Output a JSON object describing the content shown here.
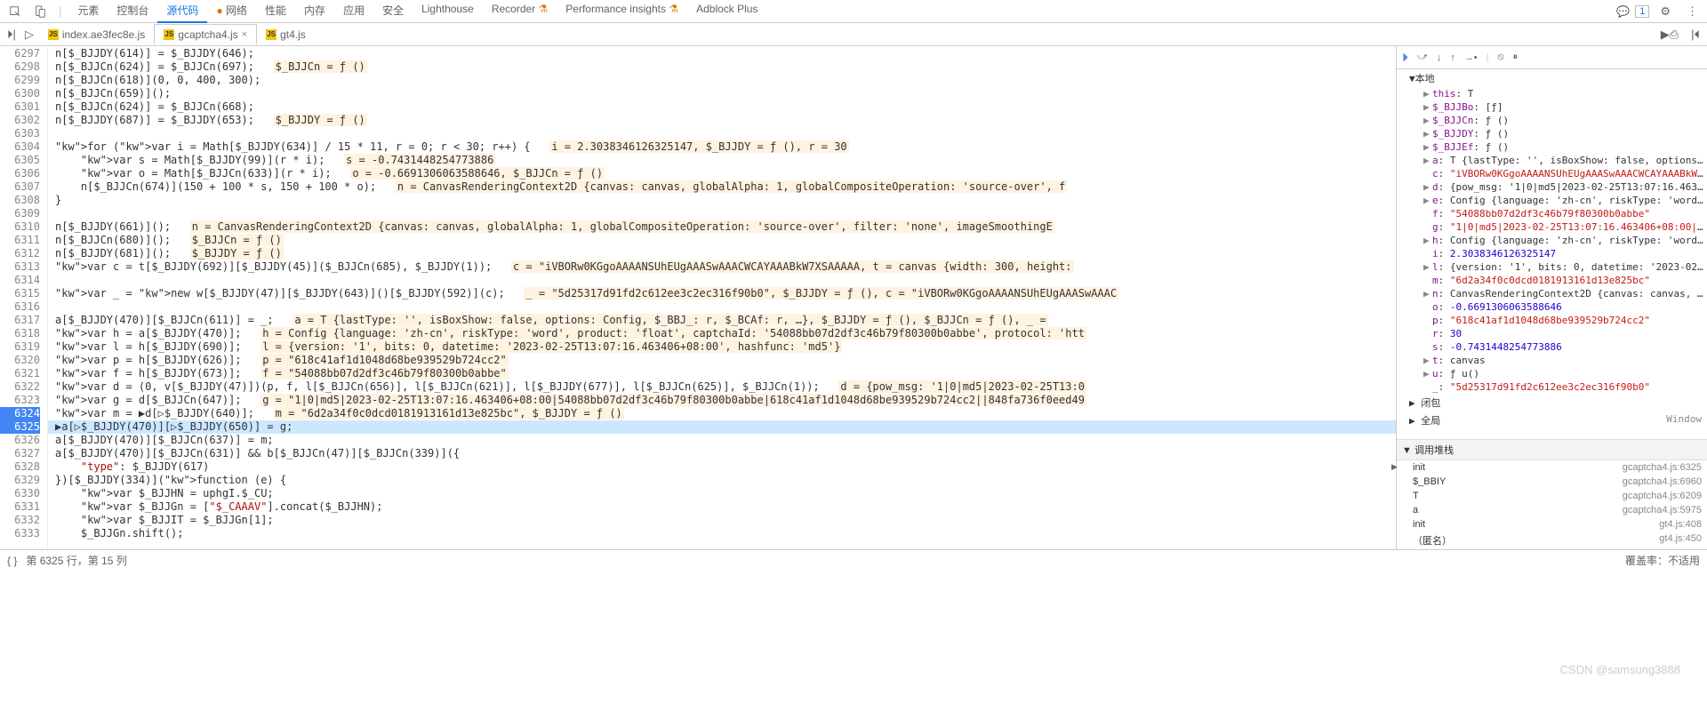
{
  "toolbar": {
    "tabs": [
      "元素",
      "控制台",
      "源代码",
      "网络",
      "性能",
      "内存",
      "应用",
      "安全",
      "Lighthouse",
      "Recorder",
      "Performance insights",
      "Adblock Plus"
    ],
    "active_tab_index": 2,
    "experimental_indices": [
      9,
      10
    ],
    "network_warn": true,
    "messages_count": "1"
  },
  "file_tabs": {
    "items": [
      {
        "name": "index.ae3fec8e.js",
        "active": false,
        "closeable": false
      },
      {
        "name": "gcaptcha4.js",
        "active": true,
        "closeable": true
      },
      {
        "name": "gt4.js",
        "active": false,
        "closeable": false
      }
    ]
  },
  "gutter": {
    "start": 6297,
    "end": 6333,
    "breakpoints": [
      6324,
      6325
    ],
    "exec_line": 6325
  },
  "code_lines": [
    {
      "n": 6297,
      "t": "n[$_BJJDY(614)] = $_BJJDY(646);"
    },
    {
      "n": 6298,
      "t": "n[$_BJJCn(624)] = $_BJJCn(697);",
      "inl": "$_BJJCn = ƒ ()"
    },
    {
      "n": 6299,
      "t": "n[$_BJJCn(618)](0, 0, 400, 300);"
    },
    {
      "n": 6300,
      "t": "n[$_BJJCn(659)]();"
    },
    {
      "n": 6301,
      "t": "n[$_BJJCn(624)] = $_BJJCn(668);"
    },
    {
      "n": 6302,
      "t": "n[$_BJJDY(687)] = $_BJJDY(653);",
      "inl": "$_BJJDY = ƒ ()"
    },
    {
      "n": 6303,
      "t": ""
    },
    {
      "n": 6304,
      "t": "for (var i = Math[$_BJJDY(634)] / 15 * 11, r = 0; r < 30; r++) {",
      "inl": "i = 2.3038346126325147, $_BJJDY = ƒ (), r = 30"
    },
    {
      "n": 6305,
      "t": "    var s = Math[$_BJJDY(99)](r * i);",
      "inl": "s = -0.7431448254773886"
    },
    {
      "n": 6306,
      "t": "    var o = Math[$_BJJCn(633)](r * i);",
      "inl": "o = -0.6691306063588646, $_BJJCn = ƒ ()"
    },
    {
      "n": 6307,
      "t": "    n[$_BJJCn(674)](150 + 100 * s, 150 + 100 * o);",
      "inl": "n = CanvasRenderingContext2D {canvas: canvas, globalAlpha: 1, globalCompositeOperation: 'source-over', f"
    },
    {
      "n": 6308,
      "t": "}"
    },
    {
      "n": 6309,
      "t": ""
    },
    {
      "n": 6310,
      "t": "n[$_BJJDY(661)]();",
      "inl": "n = CanvasRenderingContext2D {canvas: canvas, globalAlpha: 1, globalCompositeOperation: 'source-over', filter: 'none', imageSmoothingE"
    },
    {
      "n": 6311,
      "t": "n[$_BJJCn(680)]();",
      "inl": "$_BJJCn = ƒ ()"
    },
    {
      "n": 6312,
      "t": "n[$_BJJDY(681)]();",
      "inl": "$_BJJDY = ƒ ()"
    },
    {
      "n": 6313,
      "t": "var c = t[$_BJJDY(692)][$_BJJDY(45)]($_BJJCn(685), $_BJJDY(1));",
      "inl": "c = \"iVBORw0KGgoAAAANSUhEUgAAASwAAACWCAYAAABkW7XSAAAAA, t = canvas {width: 300, height:"
    },
    {
      "n": 6314,
      "t": ""
    },
    {
      "n": 6315,
      "t": "var _ = new w[$_BJJDY(47)][$_BJJDY(643)]()[$_BJJDY(592)](c);",
      "inl": "_ = \"5d25317d91fd2c612ee3c2ec316f90b0\", $_BJJDY = ƒ (), c = \"iVBORw0KGgoAAAANSUhEUgAAASwAAAC"
    },
    {
      "n": 6316,
      "t": ""
    },
    {
      "n": 6317,
      "t": "a[$_BJJDY(470)][$_BJJCn(611)] = _;",
      "inl": "a = T {lastType: '', isBoxShow: false, options: Config, $_BBJ_: r, $_BCAf: r, …}, $_BJJDY = ƒ (), $_BJJCn = ƒ (), _ ="
    },
    {
      "n": 6318,
      "t": "var h = a[$_BJJDY(470)];",
      "inl": "h = Config {language: 'zh-cn', riskType: 'word', product: 'float', captchaId: '54088bb07d2df3c46b79f80300b0abbe', protocol: 'htt"
    },
    {
      "n": 6319,
      "t": "var l = h[$_BJJDY(690)];",
      "inl": "l = {version: '1', bits: 0, datetime: '2023-02-25T13:07:16.463406+08:00', hashfunc: 'md5'}"
    },
    {
      "n": 6320,
      "t": "var p = h[$_BJJDY(626)];",
      "inl": "p = \"618c41af1d1048d68be939529b724cc2\""
    },
    {
      "n": 6321,
      "t": "var f = h[$_BJJDY(673)];",
      "inl": "f = \"54088bb07d2df3c46b79f80300b0abbe\""
    },
    {
      "n": 6322,
      "t": "var d = (0, v[$_BJJDY(47)])(p, f, l[$_BJJCn(656)], l[$_BJJCn(621)], l[$_BJJDY(677)], l[$_BJJCn(625)], $_BJJCn(1));",
      "inl": "d = {pow_msg: '1|0|md5|2023-02-25T13:0"
    },
    {
      "n": 6323,
      "t": "var g = d[$_BJJCn(647)];",
      "inl": "g = \"1|0|md5|2023-02-25T13:07:16.463406+08:00|54088bb07d2df3c46b79f80300b0abbe|618c41af1d1048d68be939529b724cc2||848fa736f0eed49"
    },
    {
      "n": 6324,
      "t": "var m = ▶d[▷$_BJJDY(640)];",
      "inl": "m = \"6d2a34f0c0dcd0181913161d13e825bc\", $_BJJDY = ƒ ()",
      "bp": true
    },
    {
      "n": 6325,
      "t": "▶a[▷$_BJJDY(470)][▷$_BJJDY(650)] = g;",
      "bp": true,
      "exec": true
    },
    {
      "n": 6326,
      "t": "a[$_BJJDY(470)][$_BJJCn(637)] = m;"
    },
    {
      "n": 6327,
      "t": "a[$_BJJDY(470)][$_BJJCn(631)] && b[$_BJJCn(47)][$_BJJCn(339)]({"
    },
    {
      "n": 6328,
      "t": "    \"type\": $_BJJDY(617)"
    },
    {
      "n": 6329,
      "t": "})[$_BJJDY(334)](function (e) {"
    },
    {
      "n": 6330,
      "t": "    var $_BJJHN = uphgI.$_CU;"
    },
    {
      "n": 6331,
      "t": "    var $_BJJGn = [\"$_CAAAV\"].concat($_BJJHN);"
    },
    {
      "n": 6332,
      "t": "    var $_BJJIT = $_BJJGn[1];"
    },
    {
      "n": 6333,
      "t": "    $_BJJGn.shift();"
    }
  ],
  "scope": {
    "local_header": "▼本地",
    "items": [
      {
        "k": "this",
        "v": "T",
        "tri": "▶"
      },
      {
        "k": "$_BJJBo",
        "v": "[ƒ]",
        "tri": "▶"
      },
      {
        "k": "$_BJJCn",
        "v": "ƒ ()",
        "tri": "▶"
      },
      {
        "k": "$_BJJDY",
        "v": "ƒ ()",
        "tri": "▶"
      },
      {
        "k": "$_BJJEf",
        "v": "ƒ ()",
        "tri": "▶"
      },
      {
        "k": "a",
        "v": "T {lastType: '', isBoxShow: false, options: C",
        "tri": "▶",
        "obj": true
      },
      {
        "k": "c",
        "v": "\"iVBORw0KGgoAAAANSUhEUgAAASwAAACWCAYAAABkW7XS",
        "str": true
      },
      {
        "k": "d",
        "v": "{pow_msg: '1|0|md5|2023-02-25T13:07:16.463406",
        "tri": "▶",
        "obj": true
      },
      {
        "k": "e",
        "v": "Config {language: 'zh-cn', riskType: 'word',",
        "tri": "▶",
        "obj": true
      },
      {
        "k": "f",
        "v": "\"54088bb07d2df3c46b79f80300b0abbe\"",
        "str": true
      },
      {
        "k": "g",
        "v": "\"1|0|md5|2023-02-25T13:07:16.463406+08:00|540",
        "str": true
      },
      {
        "k": "h",
        "v": "Config {language: 'zh-cn', riskType: 'word',",
        "tri": "▶",
        "obj": true
      },
      {
        "k": "i",
        "v": "2.3038346126325147",
        "num": true
      },
      {
        "k": "l",
        "v": "{version: '1', bits: 0, datetime: '2023-02-25",
        "tri": "▶",
        "obj": true
      },
      {
        "k": "m",
        "v": "\"6d2a34f0c0dcd0181913161d13e825bc\"",
        "str": true
      },
      {
        "k": "n",
        "v": "CanvasRenderingContext2D {canvas: canvas, glo",
        "tri": "▶",
        "obj": true
      },
      {
        "k": "o",
        "v": "-0.6691306063588646",
        "num": true
      },
      {
        "k": "p",
        "v": "\"618c41af1d1048d68be939529b724cc2\"",
        "str": true
      },
      {
        "k": "r",
        "v": "30",
        "num": true
      },
      {
        "k": "s",
        "v": "-0.7431448254773886",
        "num": true
      },
      {
        "k": "t",
        "v": "canvas",
        "tri": "▶"
      },
      {
        "k": "u",
        "v": "ƒ u()",
        "tri": "▶"
      },
      {
        "k": "_",
        "v": "\"5d25317d91fd2c612ee3c2ec316f90b0\"",
        "str": true
      }
    ],
    "closure": "▶ 闭包",
    "global_label": "▶ 全局",
    "global_val": "Window"
  },
  "callstack": {
    "title": "▼ 调用堆栈",
    "frames": [
      {
        "fn": "init",
        "loc": "gcaptcha4.js:6325",
        "cur": true
      },
      {
        "fn": "$_BBIY",
        "loc": "gcaptcha4.js:6960"
      },
      {
        "fn": "T",
        "loc": "gcaptcha4.js:6209"
      },
      {
        "fn": "a",
        "loc": "gcaptcha4.js:5975"
      },
      {
        "fn": "init",
        "loc": "gt4.js:408"
      },
      {
        "fn": "（匿名）",
        "loc": "gt4.js:450"
      }
    ]
  },
  "status": {
    "cursor": "第 6325 行，第 15 列",
    "coverage": "覆盖率：不适用"
  },
  "watermark": "CSDN @samsung3888"
}
